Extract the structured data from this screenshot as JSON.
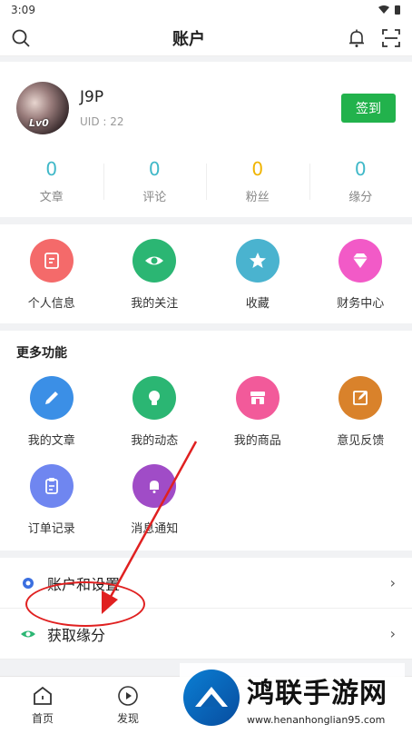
{
  "status_bar": {
    "time": "3:09"
  },
  "header": {
    "title": "账户"
  },
  "profile": {
    "username": "J9P",
    "uid": "UID : 22",
    "level": "Lv0",
    "signin_label": "签到"
  },
  "stats": [
    {
      "value": "0",
      "label": "文章"
    },
    {
      "value": "0",
      "label": "评论"
    },
    {
      "value": "0",
      "label": "粉丝"
    },
    {
      "value": "0",
      "label": "缘分"
    }
  ],
  "quick_actions": [
    {
      "label": "个人信息",
      "icon": "edit-doc-icon",
      "color": "#f46a6a"
    },
    {
      "label": "我的关注",
      "icon": "eye-icon",
      "color": "#2bb673"
    },
    {
      "label": "收藏",
      "icon": "star-icon",
      "color": "#4ab3cf"
    },
    {
      "label": "财务中心",
      "icon": "diamond-icon",
      "color": "#f25ac7"
    }
  ],
  "more": {
    "title": "更多功能",
    "items": [
      {
        "label": "我的文章",
        "icon": "pencil-icon",
        "color": "#3b8fe6"
      },
      {
        "label": "我的动态",
        "icon": "bulb-icon",
        "color": "#2bb673"
      },
      {
        "label": "我的商品",
        "icon": "store-icon",
        "color": "#f25a9a"
      },
      {
        "label": "意见反馈",
        "icon": "feedback-icon",
        "color": "#d9822b"
      },
      {
        "label": "订单记录",
        "icon": "clipboard-icon",
        "color": "#6f86f0"
      },
      {
        "label": "消息通知",
        "icon": "bell-icon",
        "color": "#a04cc7"
      }
    ]
  },
  "settings": [
    {
      "label": "账户和设置",
      "icon": "gear-icon"
    },
    {
      "label": "获取缘分",
      "icon": "eye-icon"
    }
  ],
  "bottom_nav": [
    {
      "label": "首页",
      "icon": "home-icon"
    },
    {
      "label": "发现",
      "icon": "play-icon"
    }
  ],
  "watermark": {
    "title": "鸿联手游网",
    "url": "www.henanhonglian95.com"
  },
  "colors": {
    "accent_green": "#22b24c",
    "stat_blue": "#3fb8c8",
    "stat_gold": "#f0b400",
    "annotation_red": "#e02020"
  }
}
